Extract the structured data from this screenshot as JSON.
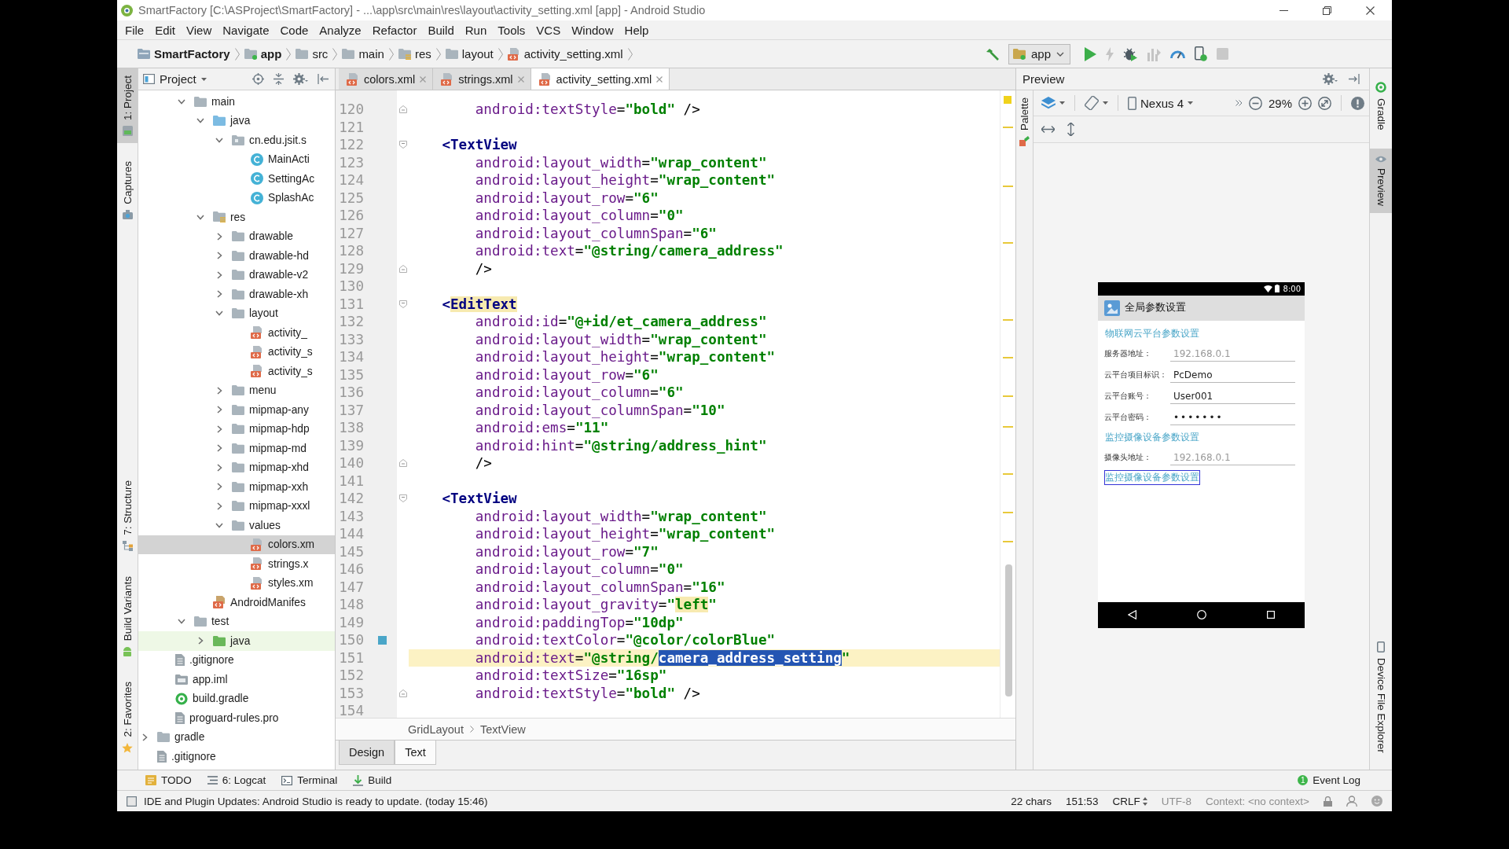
{
  "window": {
    "title": "SmartFactory [C:\\ASProject\\SmartFactory] - ...\\app\\src\\main\\res\\layout\\activity_setting.xml [app] - Android Studio"
  },
  "menu_bar": [
    "File",
    "Edit",
    "View",
    "Navigate",
    "Code",
    "Analyze",
    "Refactor",
    "Build",
    "Run",
    "Tools",
    "VCS",
    "Window",
    "Help"
  ],
  "breadcrumb": [
    {
      "label": "SmartFactory",
      "kind": "project"
    },
    {
      "label": "app",
      "kind": "module"
    },
    {
      "label": "src",
      "kind": "folder"
    },
    {
      "label": "main",
      "kind": "folder"
    },
    {
      "label": "res",
      "kind": "res-folder"
    },
    {
      "label": "layout",
      "kind": "folder"
    },
    {
      "label": "activity_setting.xml",
      "kind": "xml"
    }
  ],
  "toolbar": {
    "run_config": "app"
  },
  "left_strip": {
    "top": [
      {
        "label": "1: Project",
        "kind": "project",
        "selected": true
      },
      {
        "label": "Captures",
        "kind": "captures",
        "selected": false
      }
    ],
    "bottom": [
      {
        "label": "7: Structure",
        "kind": "structure",
        "selected": false
      },
      {
        "label": "Build Variants",
        "kind": "variants",
        "selected": false
      },
      {
        "label": "2: Favorites",
        "kind": "favorites",
        "selected": false
      }
    ]
  },
  "project_panel": {
    "title": "Project",
    "tree": [
      {
        "children": [
          {
            "children": [
              {
                "label": "main",
                "kind": "folder",
                "expanded": true,
                "selected": false,
                "children": [
                  {
                    "label": "java",
                    "kind": "source-folder",
                    "expanded": true,
                    "selected": false,
                    "children": [
                      {
                        "label": "cn.edu.jsit.s",
                        "kind": "package",
                        "expanded": true,
                        "selected": false,
                        "children": [
                          {
                            "label": "MainActi",
                            "kind": "class",
                            "selected": false
                          },
                          {
                            "label": "SettingAc",
                            "kind": "class",
                            "selected": false
                          },
                          {
                            "label": "SplashAc",
                            "kind": "class",
                            "selected": false
                          }
                        ]
                      }
                    ]
                  },
                  {
                    "label": "res",
                    "kind": "res-folder",
                    "expanded": true,
                    "selected": false,
                    "children": [
                      {
                        "label": "drawable",
                        "kind": "folder",
                        "expanded": false,
                        "selected": false
                      },
                      {
                        "label": "drawable-hd",
                        "kind": "folder",
                        "expanded": false,
                        "selected": false
                      },
                      {
                        "label": "drawable-v2",
                        "kind": "folder",
                        "expanded": false,
                        "selected": false
                      },
                      {
                        "label": "drawable-xh",
                        "kind": "folder",
                        "expanded": false,
                        "selected": false
                      },
                      {
                        "label": "layout",
                        "kind": "folder",
                        "expanded": true,
                        "selected": false,
                        "children": [
                          {
                            "label": "activity_",
                            "kind": "xml",
                            "selected": false
                          },
                          {
                            "label": "activity_s",
                            "kind": "xml",
                            "selected": false
                          },
                          {
                            "label": "activity_s",
                            "kind": "xml",
                            "selected": false
                          }
                        ]
                      },
                      {
                        "label": "menu",
                        "kind": "folder",
                        "expanded": false,
                        "selected": false
                      },
                      {
                        "label": "mipmap-any",
                        "kind": "folder",
                        "expanded": false,
                        "selected": false
                      },
                      {
                        "label": "mipmap-hdp",
                        "kind": "folder",
                        "expanded": false,
                        "selected": false
                      },
                      {
                        "label": "mipmap-md",
                        "kind": "folder",
                        "expanded": false,
                        "selected": false
                      },
                      {
                        "label": "mipmap-xhd",
                        "kind": "folder",
                        "expanded": false,
                        "selected": false
                      },
                      {
                        "label": "mipmap-xxh",
                        "kind": "folder",
                        "expanded": false,
                        "selected": false
                      },
                      {
                        "label": "mipmap-xxxl",
                        "kind": "folder",
                        "expanded": false,
                        "selected": false
                      },
                      {
                        "label": "values",
                        "kind": "folder",
                        "expanded": true,
                        "selected": false,
                        "children": [
                          {
                            "label": "colors.xm",
                            "kind": "xml",
                            "selected": true
                          },
                          {
                            "label": "strings.x",
                            "kind": "xml",
                            "selected": false
                          },
                          {
                            "label": "styles.xm",
                            "kind": "xml",
                            "selected": false
                          }
                        ]
                      }
                    ]
                  },
                  {
                    "label": "AndroidManifes",
                    "kind": "manifest",
                    "selected": false
                  }
                ]
              },
              {
                "label": "test",
                "kind": "folder",
                "expanded": true,
                "selected": false,
                "children": [
                  {
                    "label": "java",
                    "kind": "test-folder",
                    "expanded": false,
                    "selected": false
                  }
                ]
              }
            ]
          },
          {
            "label": ".gitignore",
            "kind": "file",
            "selected": false
          },
          {
            "label": "app.iml",
            "kind": "iml",
            "selected": false
          },
          {
            "label": "build.gradle",
            "kind": "gradle",
            "selected": false
          },
          {
            "label": "proguard-rules.pro",
            "kind": "file",
            "selected": false
          }
        ]
      },
      {
        "label": "gradle",
        "kind": "folder",
        "expanded": false,
        "selected": false
      },
      {
        "label": ".gitignore",
        "kind": "file",
        "selected": false
      }
    ]
  },
  "editor": {
    "tabs": [
      {
        "label": "colors.xml",
        "selected": false
      },
      {
        "label": "strings.xml",
        "selected": false
      },
      {
        "label": "activity_setting.xml",
        "selected": true
      }
    ],
    "lines": [
      {
        "number": "120",
        "kind": "fold-end",
        "current": false,
        "segments": [
          {
            "kind": "attr",
            "text": "        android:textStyle"
          },
          {
            "kind": "plain",
            "text": "="
          },
          {
            "kind": "value",
            "text": "\"bold\""
          },
          {
            "kind": "plain",
            "text": " />"
          }
        ]
      },
      {
        "number": "121",
        "kind": "code",
        "current": false
      },
      {
        "number": "122",
        "kind": "fold-start",
        "current": false,
        "segments": [
          {
            "kind": "tag",
            "text": "    <TextView"
          }
        ]
      },
      {
        "number": "123",
        "kind": "code",
        "current": false,
        "segments": [
          {
            "kind": "attr",
            "text": "        android:layout_width"
          },
          {
            "kind": "plain",
            "text": "="
          },
          {
            "kind": "value",
            "text": "\"wrap_content\""
          }
        ]
      },
      {
        "number": "124",
        "kind": "code",
        "current": false,
        "segments": [
          {
            "kind": "attr",
            "text": "        android:layout_height"
          },
          {
            "kind": "plain",
            "text": "="
          },
          {
            "kind": "value",
            "text": "\"wrap_content\""
          }
        ]
      },
      {
        "number": "125",
        "kind": "code",
        "current": false,
        "segments": [
          {
            "kind": "attr",
            "text": "        android:layout_row"
          },
          {
            "kind": "plain",
            "text": "="
          },
          {
            "kind": "value",
            "text": "\"6\""
          }
        ]
      },
      {
        "number": "126",
        "kind": "code",
        "current": false,
        "segments": [
          {
            "kind": "attr",
            "text": "        android:layout_column"
          },
          {
            "kind": "plain",
            "text": "="
          },
          {
            "kind": "value",
            "text": "\"0\""
          }
        ]
      },
      {
        "number": "127",
        "kind": "code",
        "current": false,
        "segments": [
          {
            "kind": "attr",
            "text": "        android:layout_columnSpan"
          },
          {
            "kind": "plain",
            "text": "="
          },
          {
            "kind": "value",
            "text": "\"6\""
          }
        ]
      },
      {
        "number": "128",
        "kind": "code",
        "current": false,
        "segments": [
          {
            "kind": "attr",
            "text": "        android:text"
          },
          {
            "kind": "plain",
            "text": "="
          },
          {
            "kind": "value",
            "text": "\"@string/camera_address\""
          }
        ]
      },
      {
        "number": "129",
        "kind": "fold-end",
        "current": false,
        "segments": [
          {
            "kind": "plain",
            "text": "        />"
          }
        ]
      },
      {
        "number": "130",
        "kind": "code",
        "current": false
      },
      {
        "number": "131",
        "kind": "fold-start",
        "current": false,
        "segments": [
          {
            "kind": "tag",
            "text": "    <"
          },
          {
            "kind": "tag-warn",
            "text": "EditText"
          }
        ]
      },
      {
        "number": "132",
        "kind": "code",
        "current": false,
        "segments": [
          {
            "kind": "attr",
            "text": "        android:id"
          },
          {
            "kind": "plain",
            "text": "="
          },
          {
            "kind": "value",
            "text": "\"@+id/et_camera_address\""
          }
        ]
      },
      {
        "number": "133",
        "kind": "code",
        "current": false,
        "segments": [
          {
            "kind": "attr",
            "text": "        android:layout_width"
          },
          {
            "kind": "plain",
            "text": "="
          },
          {
            "kind": "value",
            "text": "\"wrap_content\""
          }
        ]
      },
      {
        "number": "134",
        "kind": "code",
        "current": false,
        "segments": [
          {
            "kind": "attr",
            "text": "        android:layout_height"
          },
          {
            "kind": "plain",
            "text": "="
          },
          {
            "kind": "value",
            "text": "\"wrap_content\""
          }
        ]
      },
      {
        "number": "135",
        "kind": "code",
        "current": false,
        "segments": [
          {
            "kind": "attr",
            "text": "        android:layout_row"
          },
          {
            "kind": "plain",
            "text": "="
          },
          {
            "kind": "value",
            "text": "\"6\""
          }
        ]
      },
      {
        "number": "136",
        "kind": "code",
        "current": false,
        "segments": [
          {
            "kind": "attr",
            "text": "        android:layout_column"
          },
          {
            "kind": "plain",
            "text": "="
          },
          {
            "kind": "value",
            "text": "\"6\""
          }
        ]
      },
      {
        "number": "137",
        "kind": "code",
        "current": false,
        "segments": [
          {
            "kind": "attr",
            "text": "        android:layout_columnSpan"
          },
          {
            "kind": "plain",
            "text": "="
          },
          {
            "kind": "value",
            "text": "\"10\""
          }
        ]
      },
      {
        "number": "138",
        "kind": "code",
        "current": false,
        "segments": [
          {
            "kind": "attr",
            "text": "        android:ems"
          },
          {
            "kind": "plain",
            "text": "="
          },
          {
            "kind": "value",
            "text": "\"11\""
          }
        ]
      },
      {
        "number": "139",
        "kind": "code",
        "current": false,
        "segments": [
          {
            "kind": "attr",
            "text": "        android:hint"
          },
          {
            "kind": "plain",
            "text": "="
          },
          {
            "kind": "value",
            "text": "\"@string/address_hint\""
          }
        ]
      },
      {
        "number": "140",
        "kind": "fold-end",
        "current": false,
        "segments": [
          {
            "kind": "plain",
            "text": "        />"
          }
        ]
      },
      {
        "number": "141",
        "kind": "code",
        "current": false
      },
      {
        "number": "142",
        "kind": "fold-start",
        "current": false,
        "segments": [
          {
            "kind": "tag",
            "text": "    <TextView"
          }
        ]
      },
      {
        "number": "143",
        "kind": "code",
        "current": false,
        "segments": [
          {
            "kind": "attr",
            "text": "        android:layout_width"
          },
          {
            "kind": "plain",
            "text": "="
          },
          {
            "kind": "value",
            "text": "\"wrap_content\""
          }
        ]
      },
      {
        "number": "144",
        "kind": "code",
        "current": false,
        "segments": [
          {
            "kind": "attr",
            "text": "        android:layout_height"
          },
          {
            "kind": "plain",
            "text": "="
          },
          {
            "kind": "value",
            "text": "\"wrap_content\""
          }
        ]
      },
      {
        "number": "145",
        "kind": "code",
        "current": false,
        "segments": [
          {
            "kind": "attr",
            "text": "        android:layout_row"
          },
          {
            "kind": "plain",
            "text": "="
          },
          {
            "kind": "value",
            "text": "\"7\""
          }
        ]
      },
      {
        "number": "146",
        "kind": "code",
        "current": false,
        "segments": [
          {
            "kind": "attr",
            "text": "        android:layout_column"
          },
          {
            "kind": "plain",
            "text": "="
          },
          {
            "kind": "value",
            "text": "\"0\""
          }
        ]
      },
      {
        "number": "147",
        "kind": "code",
        "current": false,
        "segments": [
          {
            "kind": "attr",
            "text": "        android:layout_columnSpan"
          },
          {
            "kind": "plain",
            "text": "="
          },
          {
            "kind": "value",
            "text": "\"16\""
          }
        ]
      },
      {
        "number": "148",
        "kind": "code",
        "current": false,
        "segments": [
          {
            "kind": "attr",
            "text": "        android:layout_gravity"
          },
          {
            "kind": "plain",
            "text": "="
          },
          {
            "kind": "value",
            "text": "\""
          },
          {
            "kind": "value-warn",
            "text": "left"
          },
          {
            "kind": "value",
            "text": "\""
          }
        ]
      },
      {
        "number": "149",
        "kind": "code",
        "current": false,
        "segments": [
          {
            "kind": "attr",
            "text": "        android:paddingTop"
          },
          {
            "kind": "plain",
            "text": "="
          },
          {
            "kind": "value",
            "text": "\"10dp\""
          }
        ]
      },
      {
        "number": "150",
        "kind": "code",
        "color": "#4aa6c8",
        "current": false,
        "segments": [
          {
            "kind": "attr",
            "text": "        android:textColor"
          },
          {
            "kind": "plain",
            "text": "="
          },
          {
            "kind": "value",
            "text": "\"@color/colorBlue\""
          }
        ]
      },
      {
        "number": "151",
        "kind": "code",
        "current": true,
        "segments": [
          {
            "kind": "attr",
            "text": "        android:text"
          },
          {
            "kind": "plain",
            "text": "="
          },
          {
            "kind": "value",
            "text": "\"@string/"
          },
          {
            "kind": "selection",
            "text": "camera_address_setting"
          },
          {
            "kind": "value",
            "text": "\""
          }
        ]
      },
      {
        "number": "152",
        "kind": "code",
        "current": false,
        "segments": [
          {
            "kind": "attr",
            "text": "        android:textSize"
          },
          {
            "kind": "plain",
            "text": "="
          },
          {
            "kind": "value",
            "text": "\"16sp\""
          }
        ]
      },
      {
        "number": "153",
        "kind": "fold-end",
        "current": false,
        "segments": [
          {
            "kind": "attr",
            "text": "        android:textStyle"
          },
          {
            "kind": "plain",
            "text": "="
          },
          {
            "kind": "value",
            "text": "\"bold\""
          },
          {
            "kind": "plain",
            "text": " />"
          }
        ]
      },
      {
        "number": "154",
        "kind": "code",
        "current": false
      }
    ],
    "breadcrumb": [
      "GridLayout",
      "TextView"
    ],
    "mode_tabs": [
      {
        "label": "Design",
        "selected": false
      },
      {
        "label": "Text",
        "selected": true
      }
    ]
  },
  "preview": {
    "title": "Preview",
    "palette": "Palette",
    "device": "Nexus 4",
    "zoom": "29%",
    "phone": {
      "time": "8:00",
      "title": "全局参数设置",
      "items": [
        {
          "kind": "section",
          "text": "物联网云平台参数设置",
          "selected": false
        },
        {
          "kind": "field",
          "label": "服务器地址：",
          "placeholder": "192.168.0.1",
          "selected": false
        },
        {
          "kind": "field",
          "label": "云平台项目标识：",
          "value": "PcDemo",
          "selected": false
        },
        {
          "kind": "field",
          "label": "云平台账号：",
          "value": "User001",
          "selected": false
        },
        {
          "kind": "password",
          "label": "云平台密码：",
          "value": "•••••••",
          "selected": false
        },
        {
          "kind": "section",
          "text": "监控摄像设备参数设置",
          "selected": false
        },
        {
          "kind": "field",
          "label": "摄像头地址：",
          "placeholder": "192.168.0.1",
          "selected": false
        },
        {
          "kind": "section",
          "text": "监控摄像设备参数设置",
          "selected": true
        }
      ]
    }
  },
  "right_strip": {
    "top": [
      {
        "label": "Gradle",
        "kind": "gradle",
        "selected": false
      },
      {
        "label": "Preview",
        "kind": "preview",
        "selected": true
      }
    ],
    "bottom": [
      {
        "label": "Device File Explorer",
        "kind": "device",
        "selected": false
      }
    ]
  },
  "tool_windows": [
    {
      "label": "TODO",
      "kind": "todo"
    },
    {
      "label": "6: Logcat",
      "kind": "logcat"
    },
    {
      "label": "Terminal",
      "kind": "terminal"
    },
    {
      "label": "Build",
      "kind": "build"
    }
  ],
  "event_log": {
    "label": "Event Log",
    "count": "1"
  },
  "status_bar": {
    "message": "IDE and Plugin Updates: Android Studio is ready to update. (today 15:46)",
    "items": [
      {
        "text": "22 chars",
        "kind": "text",
        "disabled": false
      },
      {
        "text": "151:53",
        "kind": "text",
        "disabled": false
      },
      {
        "text": "CRLF",
        "kind": "dropdown",
        "disabled": false
      },
      {
        "text": "UTF-8",
        "kind": "text",
        "disabled": true
      },
      {
        "text": "Context: <no context>",
        "kind": "text",
        "disabled": true
      }
    ]
  }
}
